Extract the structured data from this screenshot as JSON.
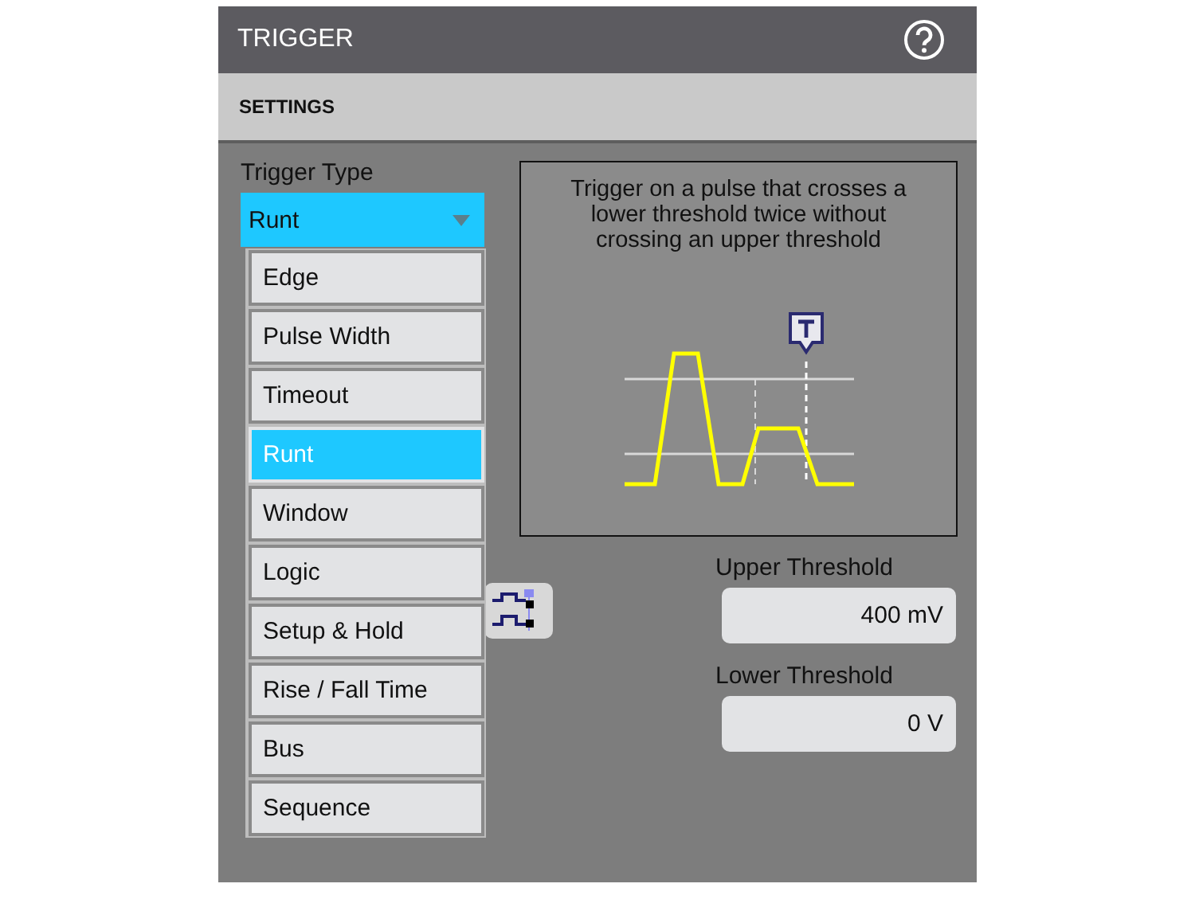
{
  "panel": {
    "title": "TRIGGER",
    "section": "SETTINGS"
  },
  "trigger_type": {
    "label": "Trigger Type",
    "value": "Runt",
    "options": [
      {
        "label": "Edge",
        "selected": false
      },
      {
        "label": "Pulse Width",
        "selected": false
      },
      {
        "label": "Timeout",
        "selected": false
      },
      {
        "label": "Runt",
        "selected": true
      },
      {
        "label": "Window",
        "selected": false
      },
      {
        "label": "Logic",
        "selected": false
      },
      {
        "label": "Setup & Hold",
        "selected": false
      },
      {
        "label": "Rise / Fall Time",
        "selected": false
      },
      {
        "label": "Bus",
        "selected": false
      },
      {
        "label": "Sequence",
        "selected": false
      }
    ]
  },
  "description": "Trigger on a pulse that crosses a lower threshold twice without crossing an upper threshold",
  "upper_threshold": {
    "label": "Upper Threshold",
    "value": "400 mV"
  },
  "lower_threshold": {
    "label": "Lower Threshold",
    "value": "0 V"
  }
}
